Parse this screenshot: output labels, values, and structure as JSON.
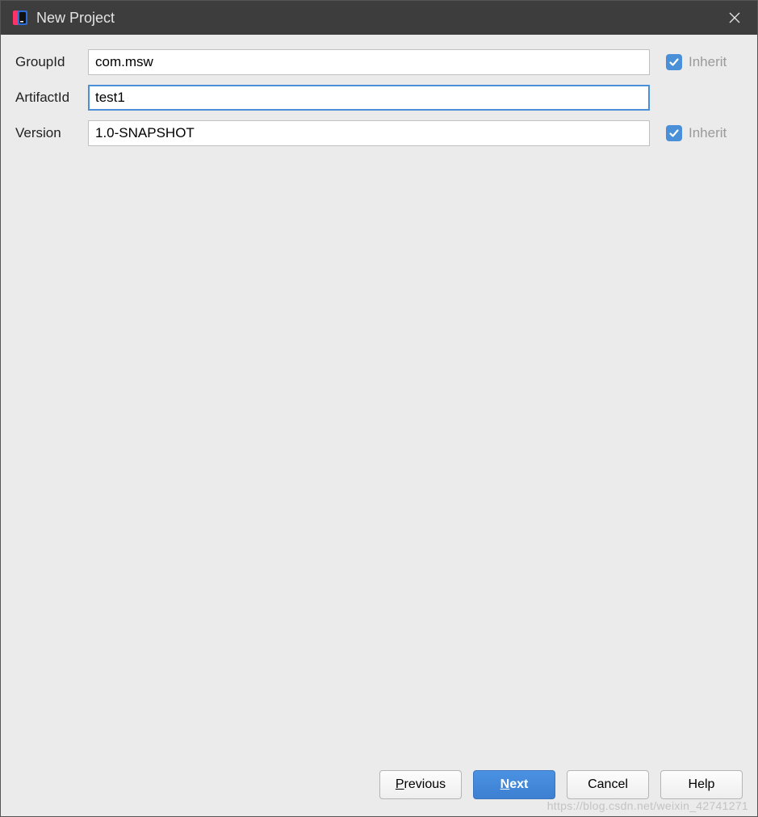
{
  "window": {
    "title": "New Project"
  },
  "form": {
    "groupId": {
      "label": "GroupId",
      "value": "com.msw",
      "inherit_checked": true
    },
    "artifactId": {
      "label": "ArtifactId",
      "value": "test1"
    },
    "version": {
      "label": "Version",
      "value": "1.0-SNAPSHOT",
      "inherit_checked": true
    },
    "inherit_label": "Inherit"
  },
  "buttons": {
    "previous": "Previous",
    "next": "Next",
    "cancel": "Cancel",
    "help": "Help"
  },
  "watermark": "https://blog.csdn.net/weixin_42741271"
}
